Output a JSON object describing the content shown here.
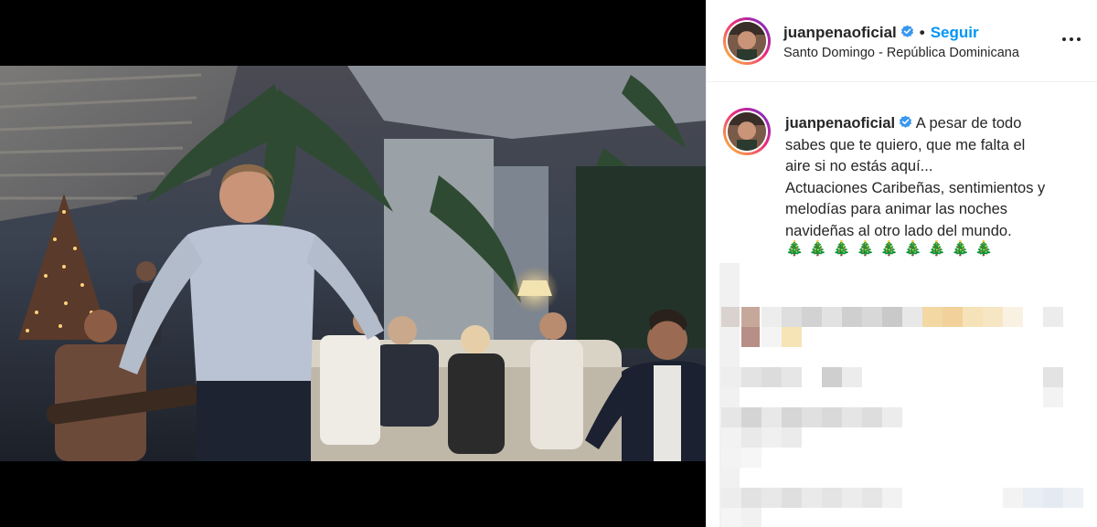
{
  "post": {
    "username": "juanpenaoficial",
    "verified_icon": "verified-badge-icon",
    "separator": "•",
    "follow_label": "Seguir",
    "location": "Santo Domingo - República Dominicana",
    "more_icon": "more-options-icon"
  },
  "caption": {
    "username": "juanpenaoficial",
    "lines": [
      "A pesar de todo",
      "sabes que te quiero, que me falta el",
      "aire si no estás aquí...",
      "Actuaciones Caribeñas, sentimientos y",
      "melodías para animar las noches",
      "navideñas al otro lado del mundo."
    ],
    "emoji": "🎄🎄🎄🎄🎄🎄🎄🎄🎄"
  },
  "colors": {
    "accent": "#0095f6",
    "text": "#262626",
    "verified": "#3897f0",
    "avatar_ring_start": "#f9ce34",
    "avatar_ring_end": "#6228d7"
  }
}
